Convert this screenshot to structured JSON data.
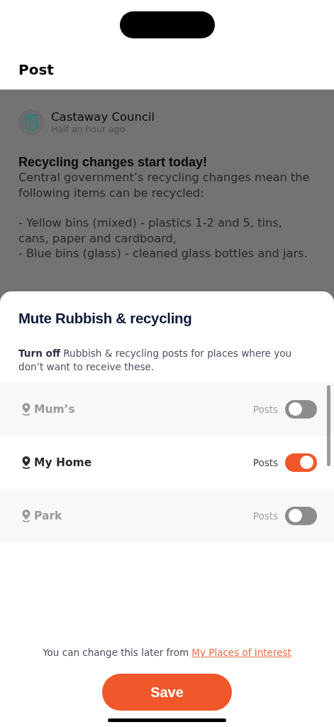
{
  "header": {
    "title": "Post"
  },
  "post": {
    "author": "Castaway Council",
    "time": "Half an hour ago",
    "headline": "Recycling changes start today!",
    "paragraphs": [
      "Central government’s recycling changes mean the following items can be recycled:",
      "- Yellow bins (mixed) - plastics 1-2 and 5, tins, cans, paper and cardboard,",
      "- Blue bins (glass) - cleaned glass bottles and jars."
    ]
  },
  "sheet": {
    "title": "Mute Rubbish & recycling",
    "description": "**Turn off** Rubbish & recycling posts for places where you don’t want to receive these.",
    "places": [
      {
        "name": "Mum’s",
        "toggle_label": "Posts",
        "on": false
      },
      {
        "name": "My Home",
        "toggle_label": "Posts",
        "on": true
      },
      {
        "name": "Park",
        "toggle_label": "Posts",
        "on": false
      }
    ],
    "footer": {
      "text": "You can change this later from",
      "link": "My Places of Interest"
    },
    "save_button": "Save"
  }
}
